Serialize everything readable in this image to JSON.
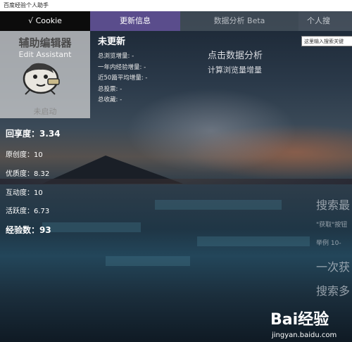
{
  "window": {
    "title": "百度经验个人助手"
  },
  "tabs": [
    {
      "label": "√ Cookie"
    },
    {
      "label": "更新信息"
    },
    {
      "label": "数据分析 Beta"
    },
    {
      "label": "个人搜"
    }
  ],
  "editor": {
    "title": "辅助编辑器",
    "subtitle": "Edit Assistant",
    "link": "未启动"
  },
  "stats": {
    "recovery": "回享度：3.34",
    "originality": "原创度：10",
    "quality": "优质度：8.32",
    "interaction": "互动度：10",
    "activity": "活跃度：6.73",
    "experience": "经验数：93"
  },
  "update": {
    "title": "未更新",
    "lines": [
      "总浏览增量: -",
      "一年内经验增量: -",
      "近50篇平均增量: -",
      "总投票: -",
      "总收藏: -"
    ]
  },
  "analysis": {
    "line1": "点击数据分析",
    "line2": "计算浏览量增量"
  },
  "search": {
    "placeholder": "这里输入搜索关键"
  },
  "right_panel": {
    "heading": "搜索最",
    "hint": "\"获取\"按钮",
    "example": "举例  10-",
    "line2": "一次获",
    "line3": "搜索多"
  },
  "watermark": {
    "brand": "Bai经验",
    "url": "jingyan.baidu.com"
  }
}
